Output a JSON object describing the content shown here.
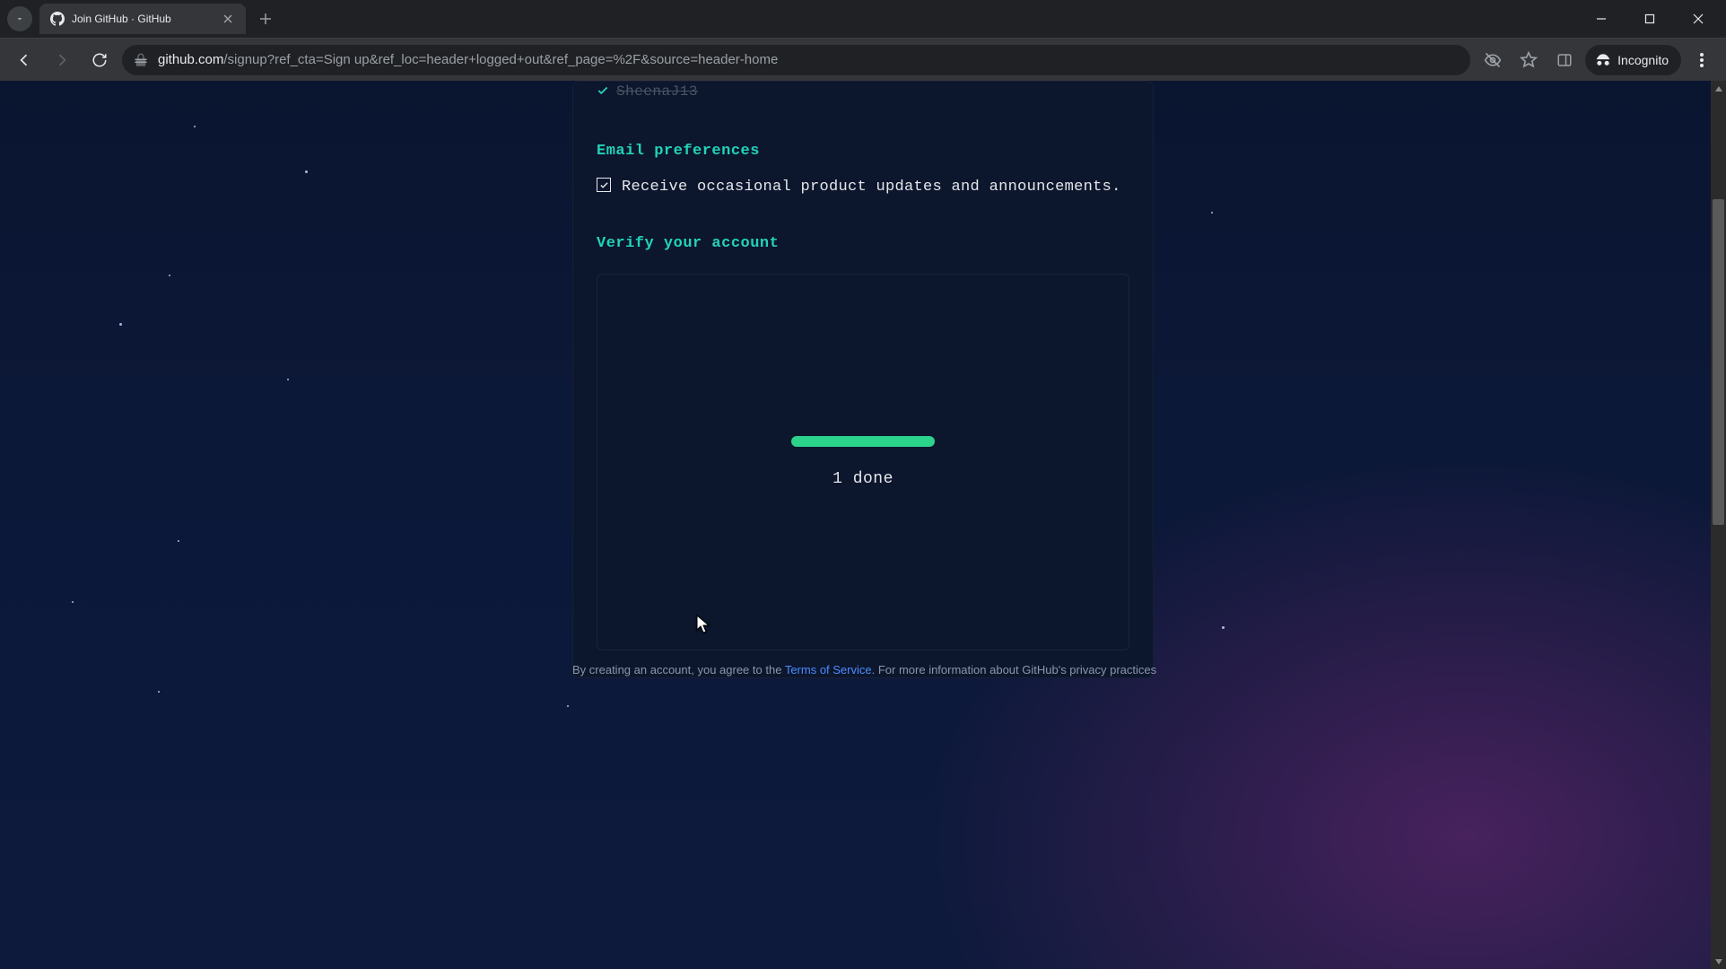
{
  "browser": {
    "tab_title": "Join GitHub · GitHub",
    "url_host": "github.com",
    "url_path": "/signup?ref_cta=Sign up&ref_loc=header+logged+out&ref_page=%2F&source=header-home",
    "incognito_label": "Incognito"
  },
  "signup": {
    "previous_username": "SheenaJ13",
    "email_prefs_heading": "Email preferences",
    "email_prefs_label": "Receive occasional product updates and announcements.",
    "email_prefs_checked": true,
    "verify_heading": "Verify your account",
    "progress_text": "1 done"
  },
  "footer": {
    "prefix": "By creating an account, you agree to the ",
    "link": "Terms of Service",
    "suffix": ". For more information about GitHub's privacy practices"
  },
  "colors": {
    "accent_teal": "#22d3b8",
    "progress_green": "#2bd48a",
    "card_bg": "#0c162d"
  }
}
